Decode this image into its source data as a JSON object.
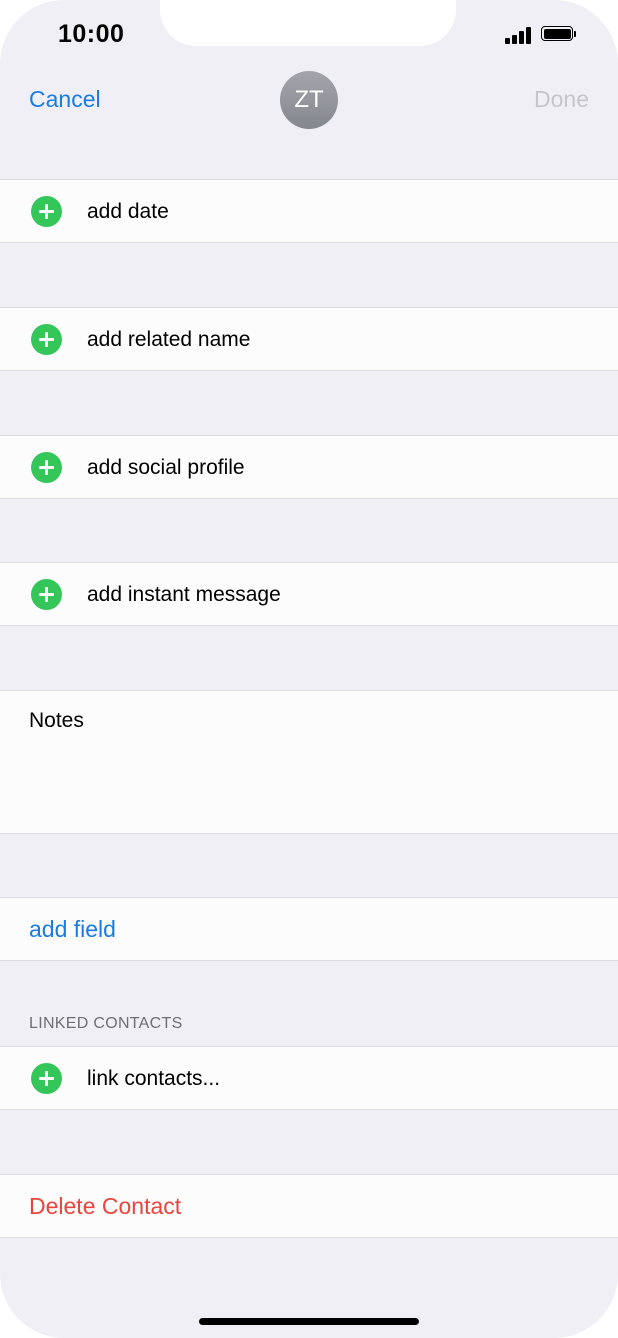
{
  "status_bar": {
    "time": "10:00",
    "signal_icon": "cellular-signal-icon",
    "battery_icon": "battery-full-icon"
  },
  "nav": {
    "cancel_label": "Cancel",
    "done_label": "Done",
    "avatar_initials": "ZT"
  },
  "rows": {
    "add_date": "add date",
    "add_related_name": "add related name",
    "add_social_profile": "add social profile",
    "add_instant_message": "add instant message",
    "notes_label": "Notes",
    "add_field": "add field",
    "linked_contacts_header": "LINKED CONTACTS",
    "link_contacts": "link contacts...",
    "delete_contact": "Delete Contact"
  },
  "colors": {
    "accent": "#1a7ce0",
    "destructive": "#e8453c",
    "add_icon": "#35c65a",
    "background": "#f0eff5",
    "done_disabled": "#c6c6ca"
  }
}
